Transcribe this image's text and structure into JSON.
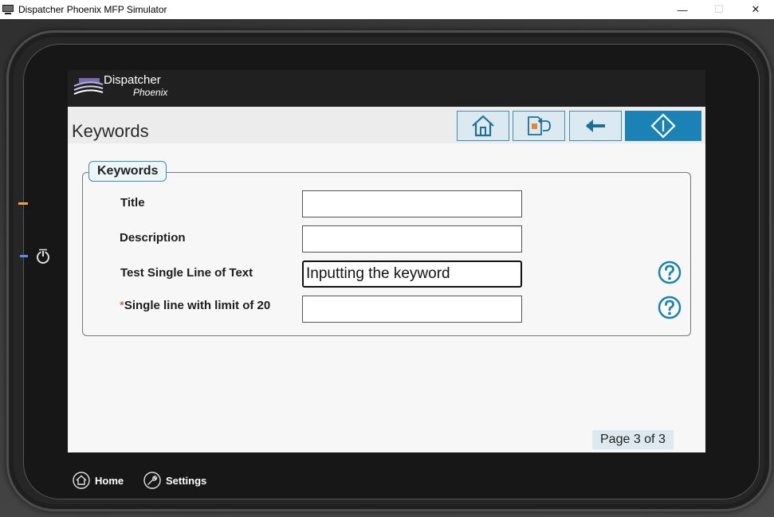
{
  "window": {
    "title": "Dispatcher Phoenix MFP Simulator",
    "minimize": "—",
    "maximize": "☐",
    "close": "✕"
  },
  "brand": {
    "name": "Dispatcher",
    "sub": "Phoenix"
  },
  "header": {
    "title": "Keywords"
  },
  "toolbar": {
    "home_icon": "home-icon",
    "return_icon": "return-icon",
    "back_icon": "back-arrow-icon",
    "start_icon": "start-icon",
    "accent": "#1a82b4"
  },
  "form": {
    "legend": "Keywords",
    "fields": [
      {
        "label": "Title",
        "value": "",
        "required": false
      },
      {
        "label": "Description",
        "value": "",
        "required": false
      },
      {
        "label": "Test Single Line of Text",
        "value": "Inputting the keyword",
        "required": false
      },
      {
        "label": "Single line with limit of 20",
        "value": "",
        "required": true
      }
    ],
    "required_marker": "*"
  },
  "pager": {
    "text": "Page 3 of 3"
  },
  "device_menu": {
    "home_label": "Home",
    "settings_label": "Settings"
  }
}
